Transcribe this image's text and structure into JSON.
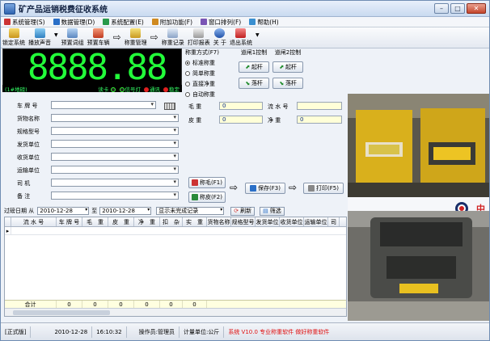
{
  "window": {
    "title": "矿产品运销税费征收系统"
  },
  "menu": [
    "系统管理(S)",
    "数据管理(D)",
    "系统配置(E)",
    "附加功能(F)",
    "窗口排列(F)",
    "帮助(H)"
  ],
  "toolbar": {
    "lock": "锁定系统",
    "sound": "播放声音",
    "preset_detail": "预置词组",
    "preset_vehicle": "预置车辆",
    "weigh_manage": "称重管理",
    "weigh_record": "称重记录",
    "print_report": "打印报表",
    "about": "关 于",
    "exit": "退出系统"
  },
  "display": {
    "value": "8888.88",
    "scale": "(1#地磅)",
    "read": "读卡",
    "signal": "信号灯",
    "comm": "通讯",
    "stable": "稳定"
  },
  "weigh_mode": {
    "label": "称重方式(F7)",
    "options": [
      "标准称重",
      "简单称重",
      "直接净重",
      "自动称重"
    ],
    "selected": 0
  },
  "gate1": {
    "label": "道闸1控制",
    "up": "起杆",
    "down": "落杆"
  },
  "gate2": {
    "label": "道闸2控制",
    "up": "起杆",
    "down": "落杆"
  },
  "form": {
    "plate": "车 牌 号",
    "cargo": "货物名称",
    "spec": "规格型号",
    "sender": "发货单位",
    "receiver": "收货单位",
    "transport": "运输单位",
    "driver": "司    机",
    "remark": "备    注",
    "gross_label": "毛    重",
    "tare_label": "皮    重",
    "serial_label": "流 水 号",
    "net_label": "净    重",
    "gross": "0",
    "tare": "0",
    "net": "0",
    "serial": ""
  },
  "actions": {
    "weigh_gross": "称毛(F1)",
    "weigh_tare": "称皮(F2)",
    "save": "保存(F3)",
    "print": "打印(F5)"
  },
  "filter": {
    "label": "过磅日期 从",
    "from": "2010-12-28",
    "to_label": "至",
    "to": "2010-12-28",
    "mode": "显示未完成记录",
    "refresh": "刷新",
    "filter": "筛选"
  },
  "grid": {
    "columns": [
      "流 水 号",
      "车 牌 号",
      "毛　重",
      "皮　重",
      "净　重",
      "扣　杂",
      "实　重",
      "货物名称",
      "规格型号",
      "发货单位",
      "收货单位",
      "运输单位",
      "司"
    ],
    "footer": [
      "合计",
      "0",
      "0",
      "0",
      "0",
      "0",
      "0"
    ]
  },
  "status": {
    "edition": "[正式版]",
    "date": "2010-12-28",
    "time": "16:10:32",
    "operator": "操作员:管理员",
    "unit": "计量单位:公斤",
    "ad": "系统 V10.0 专业称重软件  做好称重软件"
  },
  "colors": {
    "display_bg": "#000000",
    "display_digits": "#22ff3a",
    "input_bg": "#ffffd8",
    "status_red": "#e01010"
  },
  "logo": {
    "text": "中"
  }
}
